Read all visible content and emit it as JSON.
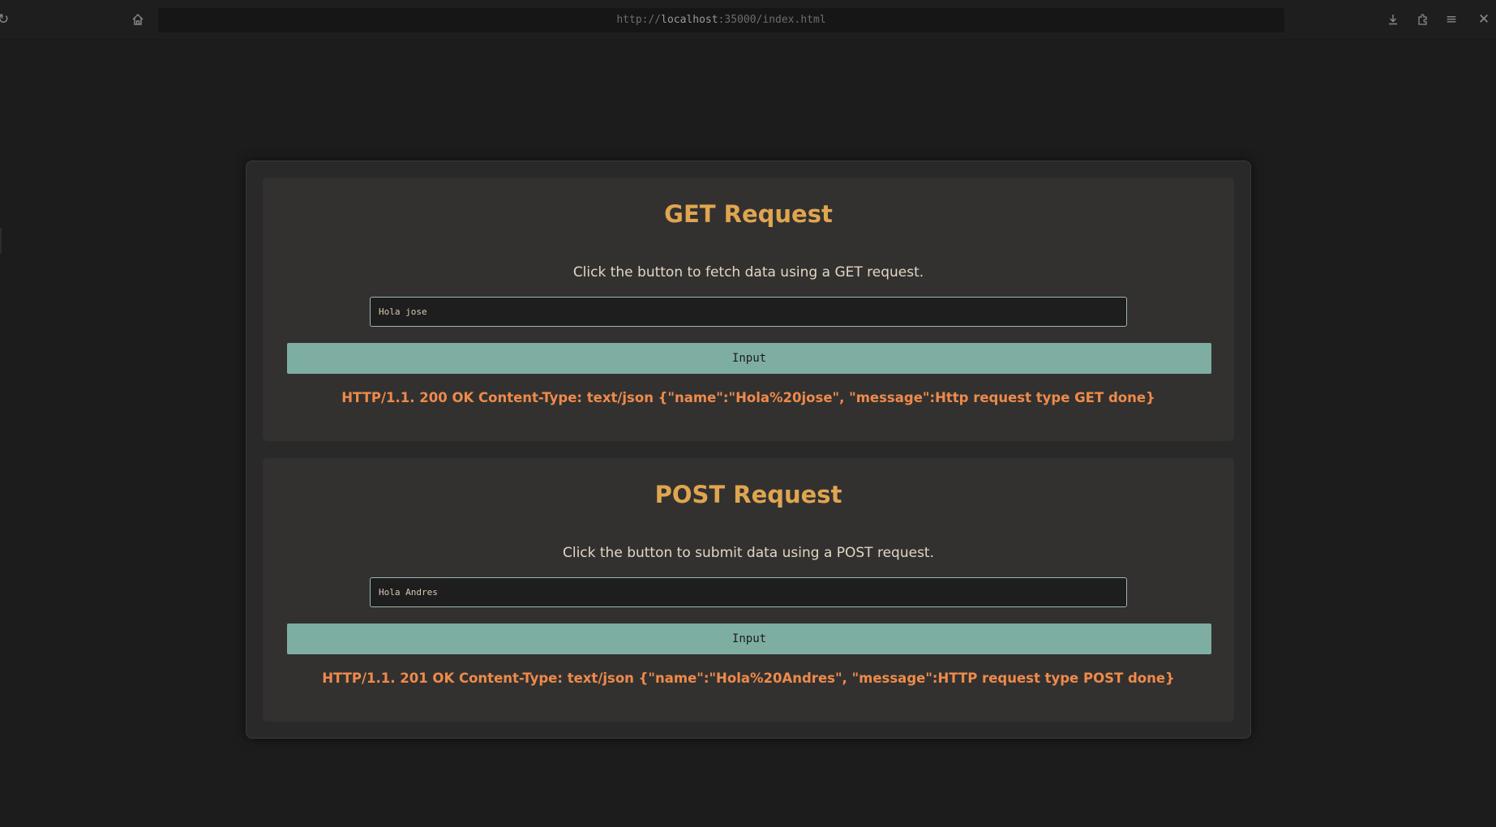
{
  "browser": {
    "url_prefix": "http://",
    "url_host": "localhost",
    "url_rest": ":35000/index.html",
    "icons": [
      "reload-icon",
      "home-icon",
      "download-icon",
      "extensions-icon",
      "menu-icon",
      "close-icon"
    ]
  },
  "get_section": {
    "title": "GET Request",
    "description": "Click the button to fetch data using a GET request.",
    "input_value": "Hola jose",
    "button_label": "Input",
    "response": "HTTP/1.1. 200 OK Content-Type: text/json {\"name\":\"Hola%20jose\", \"message\":Http request type GET done}"
  },
  "post_section": {
    "title": "POST Request",
    "description": "Click the button to submit data using a POST request.",
    "input_value": "Hola Andres",
    "button_label": "Input",
    "response": "HTTP/1.1. 201 OK Content-Type: text/json {\"name\":\"Hola%20Andres\", \"message\":HTTP request type POST done}"
  },
  "colors": {
    "background": "#1c1c1c",
    "card": "#323130",
    "title": "#e0a550",
    "button": "#7eaea2",
    "response": "#ee8a4a"
  }
}
